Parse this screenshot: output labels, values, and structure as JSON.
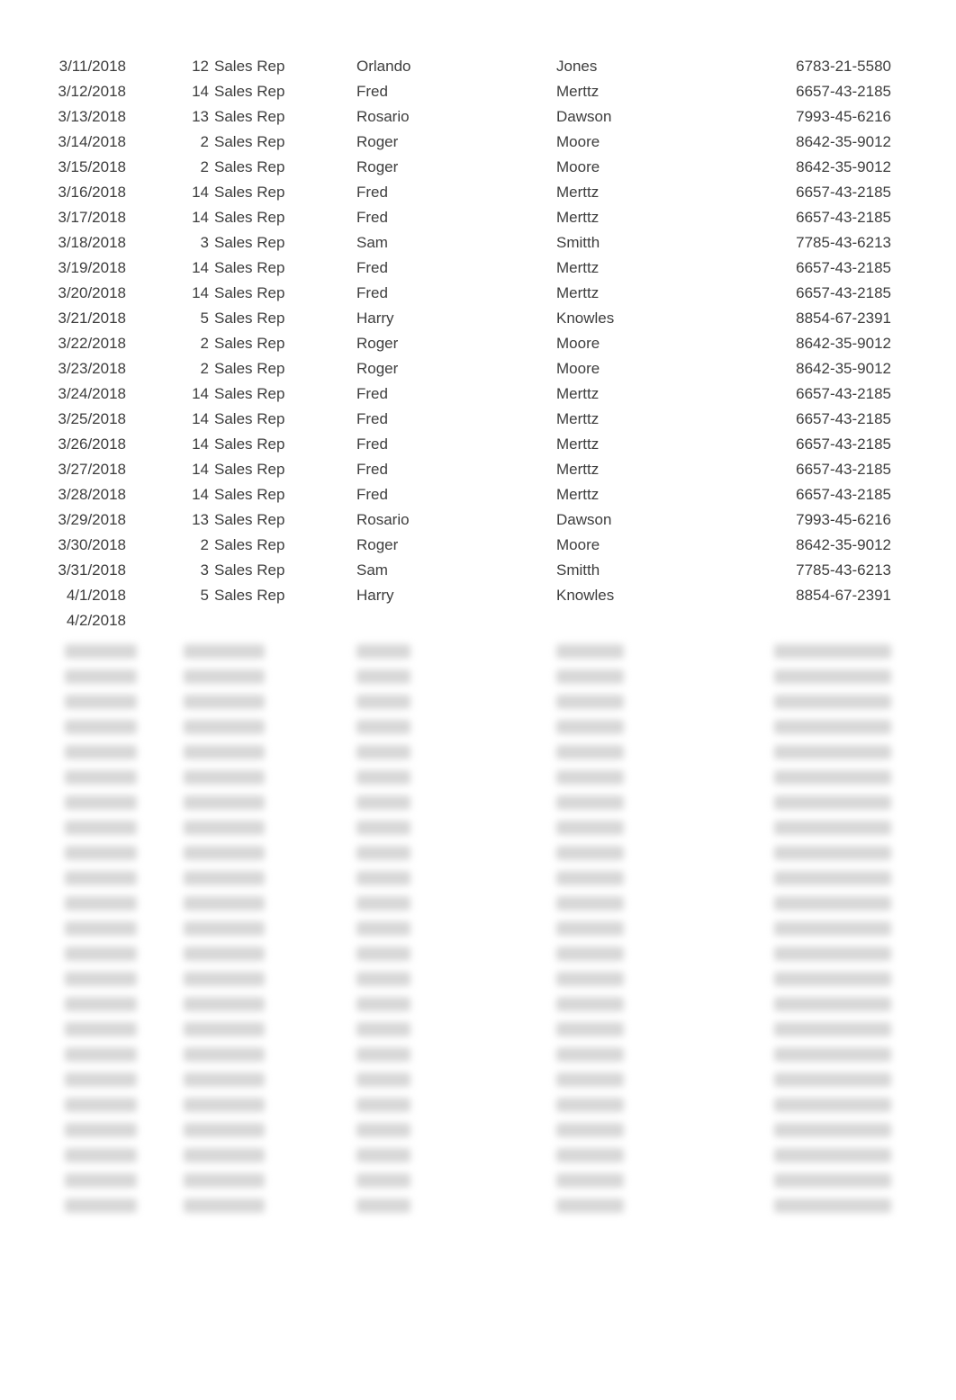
{
  "table": {
    "rows": [
      {
        "date": "3/11/2018",
        "num": "12",
        "role": "Sales Rep",
        "first": "Orlando",
        "last": "Jones",
        "id": "6783-21-5580"
      },
      {
        "date": "3/12/2018",
        "num": "14",
        "role": "Sales Rep",
        "first": "Fred",
        "last": "Merttz",
        "id": "6657-43-2185"
      },
      {
        "date": "3/13/2018",
        "num": "13",
        "role": "Sales Rep",
        "first": "Rosario",
        "last": "Dawson",
        "id": "7993-45-6216"
      },
      {
        "date": "3/14/2018",
        "num": "2",
        "role": "Sales Rep",
        "first": "Roger",
        "last": "Moore",
        "id": "8642-35-9012"
      },
      {
        "date": "3/15/2018",
        "num": "2",
        "role": "Sales Rep",
        "first": "Roger",
        "last": "Moore",
        "id": "8642-35-9012"
      },
      {
        "date": "3/16/2018",
        "num": "14",
        "role": "Sales Rep",
        "first": "Fred",
        "last": "Merttz",
        "id": "6657-43-2185"
      },
      {
        "date": "3/17/2018",
        "num": "14",
        "role": "Sales Rep",
        "first": "Fred",
        "last": "Merttz",
        "id": "6657-43-2185"
      },
      {
        "date": "3/18/2018",
        "num": "3",
        "role": "Sales Rep",
        "first": "Sam",
        "last": "Smitth",
        "id": "7785-43-6213"
      },
      {
        "date": "3/19/2018",
        "num": "14",
        "role": "Sales Rep",
        "first": "Fred",
        "last": "Merttz",
        "id": "6657-43-2185"
      },
      {
        "date": "3/20/2018",
        "num": "14",
        "role": "Sales Rep",
        "first": "Fred",
        "last": "Merttz",
        "id": "6657-43-2185"
      },
      {
        "date": "3/21/2018",
        "num": "5",
        "role": "Sales Rep",
        "first": "Harry",
        "last": "Knowles",
        "id": "8854-67-2391"
      },
      {
        "date": "3/22/2018",
        "num": "2",
        "role": "Sales Rep",
        "first": "Roger",
        "last": "Moore",
        "id": "8642-35-9012"
      },
      {
        "date": "3/23/2018",
        "num": "2",
        "role": "Sales Rep",
        "first": "Roger",
        "last": "Moore",
        "id": "8642-35-9012"
      },
      {
        "date": "3/24/2018",
        "num": "14",
        "role": "Sales Rep",
        "first": "Fred",
        "last": "Merttz",
        "id": "6657-43-2185"
      },
      {
        "date": "3/25/2018",
        "num": "14",
        "role": "Sales Rep",
        "first": "Fred",
        "last": "Merttz",
        "id": "6657-43-2185"
      },
      {
        "date": "3/26/2018",
        "num": "14",
        "role": "Sales Rep",
        "first": "Fred",
        "last": "Merttz",
        "id": "6657-43-2185"
      },
      {
        "date": "3/27/2018",
        "num": "14",
        "role": "Sales Rep",
        "first": "Fred",
        "last": "Merttz",
        "id": "6657-43-2185"
      },
      {
        "date": "3/28/2018",
        "num": "14",
        "role": "Sales Rep",
        "first": "Fred",
        "last": "Merttz",
        "id": "6657-43-2185"
      },
      {
        "date": "3/29/2018",
        "num": "13",
        "role": "Sales Rep",
        "first": "Rosario",
        "last": "Dawson",
        "id": "7993-45-6216"
      },
      {
        "date": "3/30/2018",
        "num": "2",
        "role": "Sales Rep",
        "first": "Roger",
        "last": "Moore",
        "id": "8642-35-9012"
      },
      {
        "date": "3/31/2018",
        "num": "3",
        "role": "Sales Rep",
        "first": "Sam",
        "last": "Smitth",
        "id": "7785-43-6213"
      },
      {
        "date": "4/1/2018",
        "num": "5",
        "role": "Sales Rep",
        "first": "Harry",
        "last": "Knowles",
        "id": "8854-67-2391"
      },
      {
        "date": "4/2/2018",
        "num": "",
        "role": "",
        "first": "",
        "last": "",
        "id": ""
      }
    ],
    "blurred_row_count": 23
  }
}
